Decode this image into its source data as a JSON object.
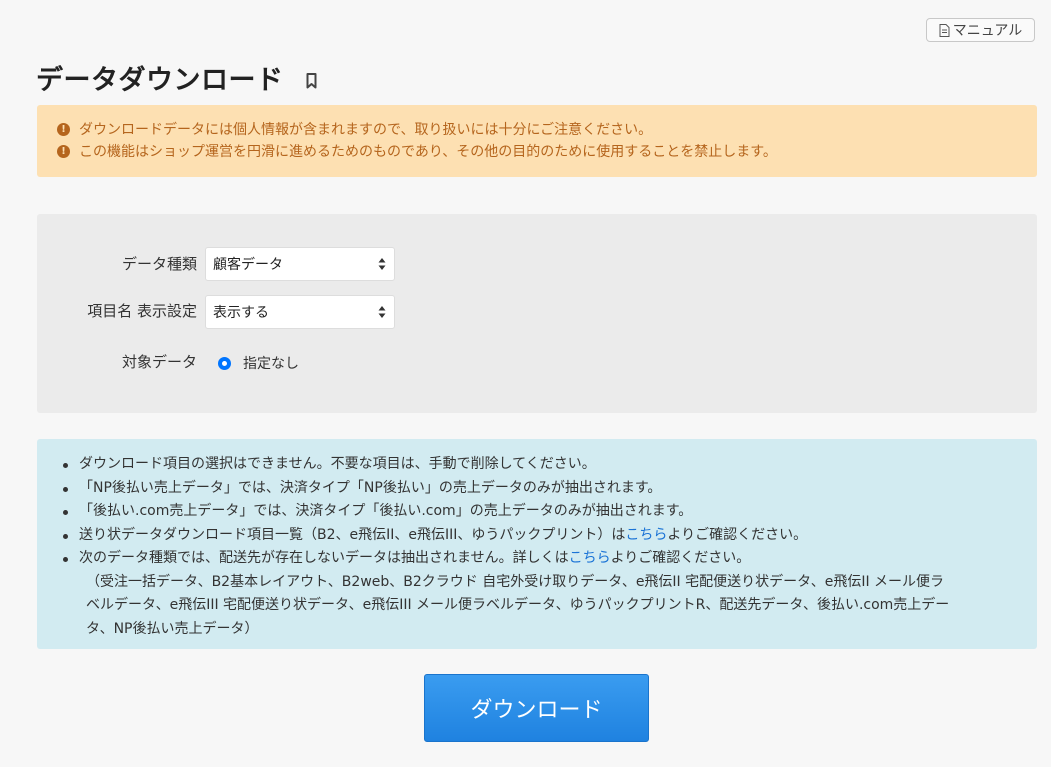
{
  "header": {
    "manual_label": "マニュアル",
    "page_title": "データダウンロード"
  },
  "warnings": [
    "ダウンロードデータには個人情報が含まれますので、取り扱いには十分にご注意ください。",
    "この機能はショップ運営を円滑に進めるためのものであり、その他の目的のために使用することを禁止します。"
  ],
  "form": {
    "data_type": {
      "label": "データ種類",
      "selected": "顧客データ"
    },
    "header_display": {
      "label": "項目名 表示設定",
      "selected": "表示する"
    },
    "target": {
      "label": "対象データ",
      "option": "指定なし",
      "checked": true
    }
  },
  "notes": {
    "item1": "ダウンロード項目の選択はできません。不要な項目は、手動で削除してください。",
    "item2": "「NP後払い売上データ」では、決済タイプ「NP後払い」の売上データのみが抽出されます。",
    "item3": "「後払い.com売上データ」では、決済タイプ「後払い.com」の売上データのみが抽出されます。",
    "item4_before": "送り状データダウンロード項目一覧（B2、e飛伝II、e飛伝III、ゆうパックプリント）は",
    "item4_link": "こちら",
    "item4_after": "よりご確認ください。",
    "item5_before": "次のデータ種類では、配送先が存在しないデータは抽出されません。詳しくは",
    "item5_link": "こちら",
    "item5_after": "よりご確認ください。",
    "sub1": "（受注一括データ、B2基本レイアウト、B2web、B2クラウド 自宅外受け取りデータ、e飛伝II 宅配便送り状データ、e飛伝II メール便ラ",
    "sub2": "ベルデータ、e飛伝III 宅配便送り状データ、e飛伝III メール便ラベルデータ、ゆうパックプリントR、配送先データ、後払い.com売上デー",
    "sub3": "タ、NP後払い売上データ）"
  },
  "actions": {
    "download_label": "ダウンロード"
  },
  "colors": {
    "primary": "#2a8ee8",
    "warning_bg": "#fde0b2",
    "warning_text": "#b5651d",
    "info_bg": "#d2ebf1",
    "link": "#1a73d6"
  },
  "icons": {
    "manual": "document-icon",
    "bookmark": "bookmark-icon",
    "warning": "exclamation-circle-icon"
  }
}
